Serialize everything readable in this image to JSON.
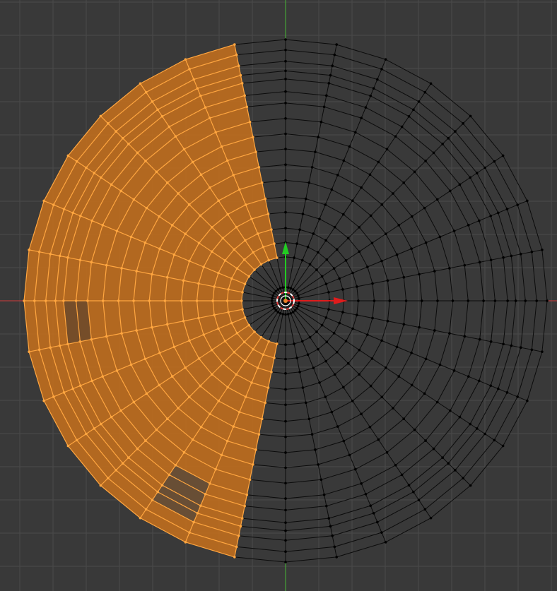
{
  "viewport": {
    "view": "top-orthographic",
    "mode": "edit-mode",
    "selection_mode": "face"
  },
  "colors": {
    "background": "#393939",
    "grid": "#4a4a4a",
    "wire_unselected": "#0b0b0b",
    "vertex_unselected": "#000000",
    "face_selected_fill": "#c06e1e",
    "wire_selected": "#ffa640",
    "x_axis": "#d13a3a",
    "y_axis": "#46b835",
    "gizmo_x": "#e01c1c",
    "gizmo_y": "#22cc22",
    "cursor_ring_red": "#e53a3a",
    "cursor_ring_white": "#ffffff"
  },
  "mesh": {
    "type": "circle-fan",
    "segments": 32,
    "ring_radius_fractions": [
      0.052,
      0.168,
      0.223,
      0.278,
      0.339,
      0.398,
      0.461,
      0.521,
      0.581,
      0.639,
      0.698,
      0.757,
      0.801,
      0.849,
      0.88,
      0.917,
      0.96,
      1.0
    ],
    "selected_segment_range": [
      9,
      23
    ],
    "selected_inner_ring_index": 1,
    "partial_selected_segments": [
      {
        "segment": 22,
        "ring_from": 6,
        "ring_to": 11
      }
    ],
    "highlighted_faces": [
      {
        "segment": 16,
        "ring_from": 11,
        "ring_to": 13
      }
    ]
  },
  "gizmo": {
    "axes": [
      "x",
      "y"
    ],
    "pivot": "3d-cursor"
  }
}
